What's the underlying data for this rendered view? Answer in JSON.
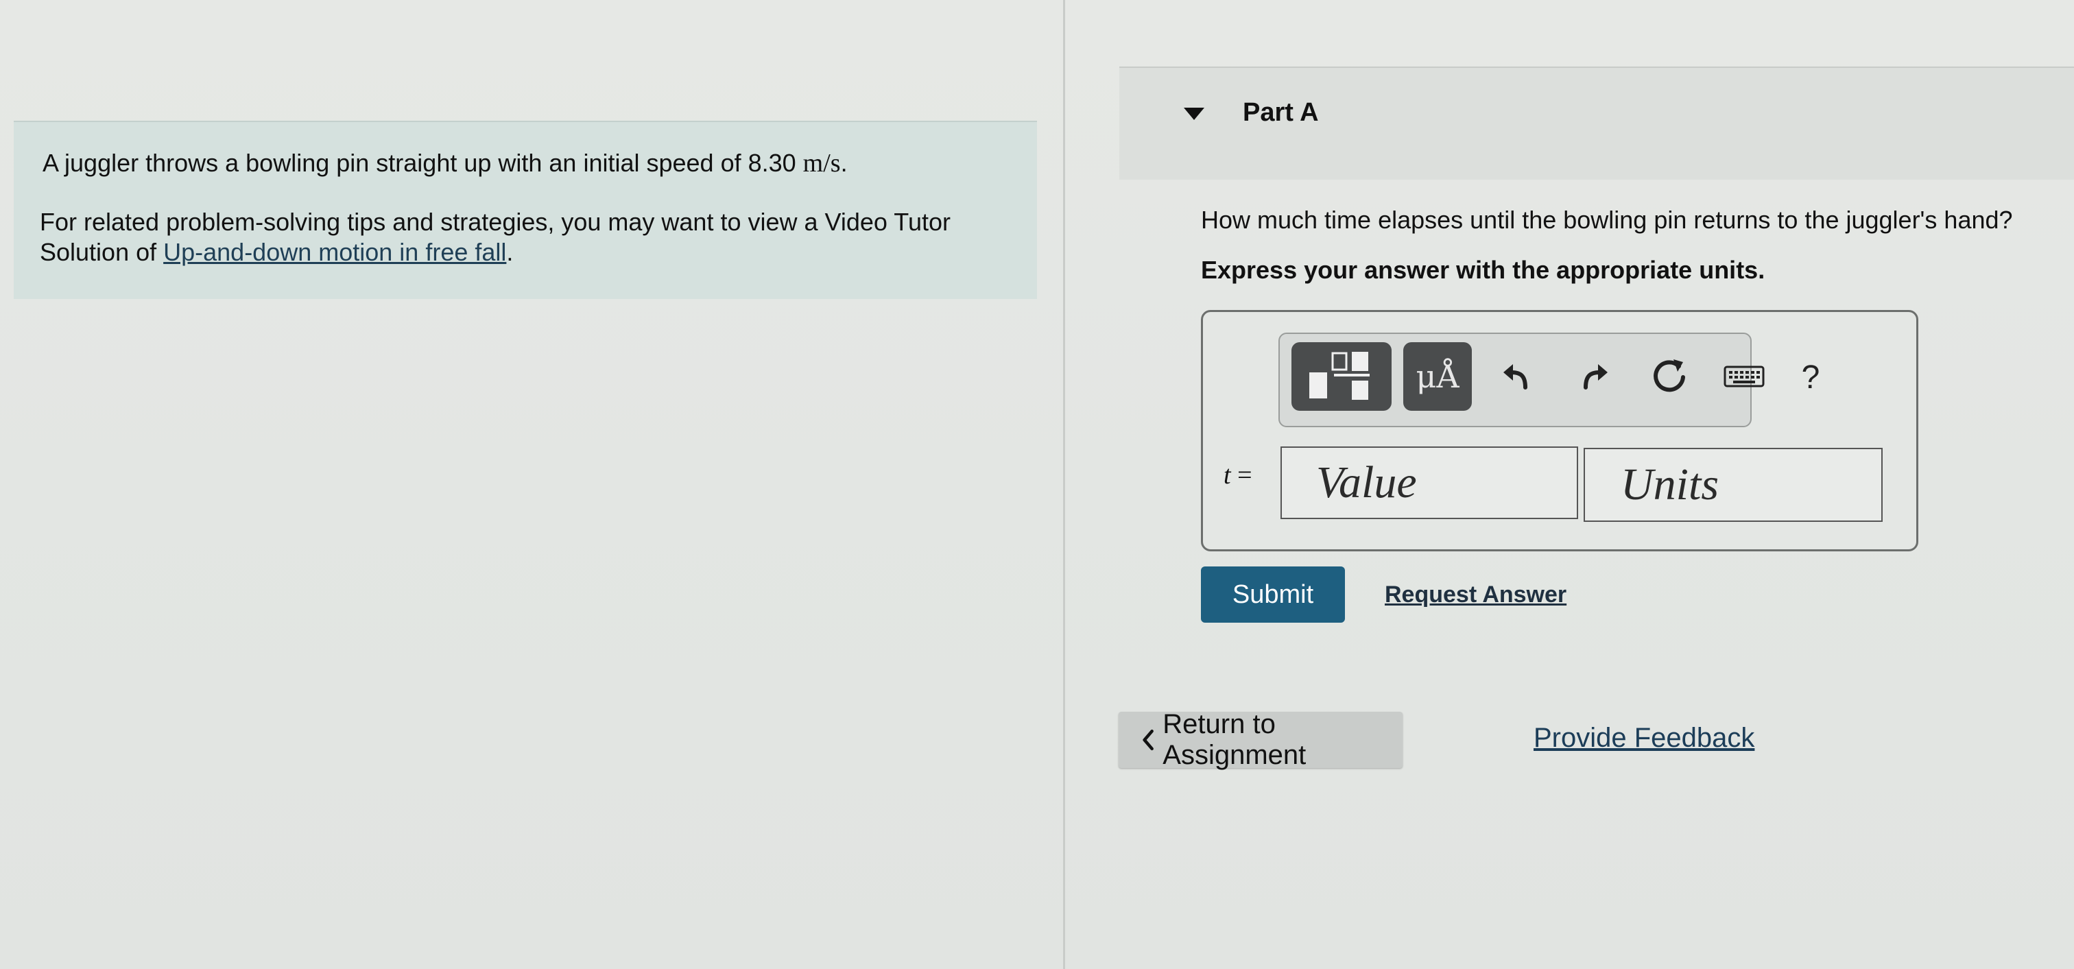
{
  "problem": {
    "intro_text": "A juggler throws a bowling pin straight up with an initial speed of 8.30 ",
    "intro_unit": "m/s",
    "intro_end": ".",
    "tips_prefix": "For related problem-solving tips and strategies, you may want to view a Video Tutor Solution of ",
    "tips_link": "Up-and-down motion in free fall",
    "tips_suffix": "."
  },
  "part": {
    "title": "Part A",
    "question": "How much time elapses until the bowling pin returns to the juggler's hand?",
    "instruction": "Express your answer with the appropriate units."
  },
  "toolbar": {
    "template_icon": "fraction-template-icon",
    "units_symbol": "μÅ",
    "undo_icon": "undo-icon",
    "redo_icon": "redo-icon",
    "reset_icon": "reset-icon",
    "keyboard_icon": "keyboard-icon",
    "help_label": "?"
  },
  "answer": {
    "var_letter": "t",
    "equals": " =",
    "value_placeholder": "Value",
    "units_placeholder": "Units"
  },
  "actions": {
    "submit_label": "Submit",
    "request_label": "Request Answer",
    "return_label": "Return to Assignment",
    "feedback_label": "Provide Feedback"
  },
  "colors": {
    "submit_bg": "#1e5f80",
    "problem_bg": "#d5e1de",
    "toolbar_btn": "#4a4c4d"
  }
}
